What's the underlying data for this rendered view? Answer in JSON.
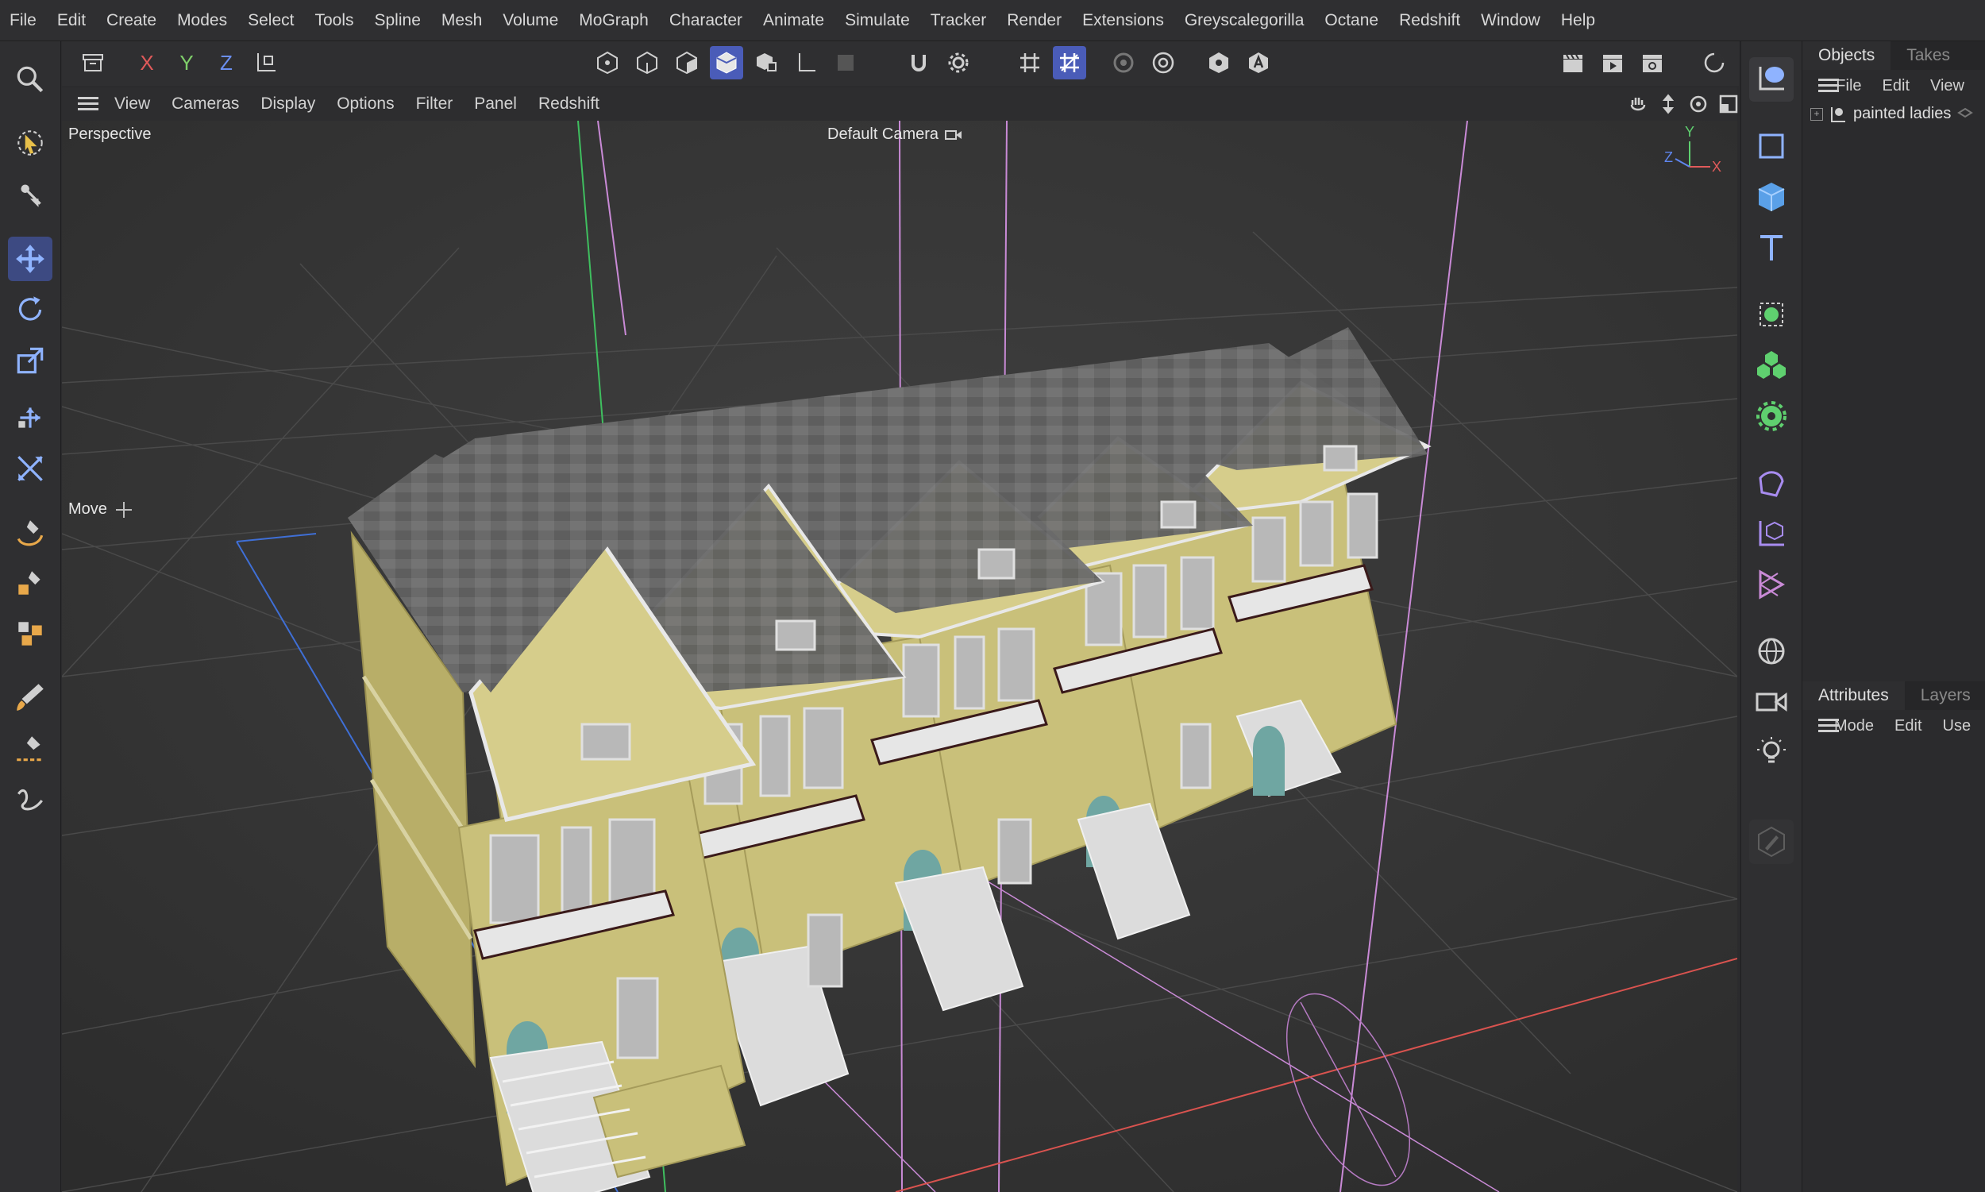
{
  "menu": [
    "File",
    "Edit",
    "Create",
    "Modes",
    "Select",
    "Tools",
    "Spline",
    "Mesh",
    "Volume",
    "MoGraph",
    "Character",
    "Animate",
    "Simulate",
    "Tracker",
    "Render",
    "Extensions",
    "Greyscalegorilla",
    "Octane",
    "Redshift",
    "Window",
    "Help"
  ],
  "toolbar": {
    "x_label": "X",
    "y_label": "Y",
    "z_label": "Z"
  },
  "viewport_menu": [
    "View",
    "Cameras",
    "Display",
    "Options",
    "Filter",
    "Panel",
    "Redshift"
  ],
  "viewport": {
    "view_name": "Perspective",
    "camera": "Default Camera",
    "tool_label": "Move",
    "axis_x": "X",
    "axis_y": "Y",
    "axis_z": "Z"
  },
  "objects_panel": {
    "tabs": [
      "Objects",
      "Takes"
    ],
    "menu": [
      "File",
      "Edit",
      "View"
    ],
    "tree_item": "painted ladies"
  },
  "attributes_panel": {
    "tabs": [
      "Attributes",
      "Layers"
    ],
    "menu": [
      "Mode",
      "Edit",
      "Use"
    ]
  },
  "colors": {
    "accent": "#4a5cb8",
    "house_wall": "#c9c07a",
    "roof": "#6e6e6e",
    "window": "#b8b8b8",
    "door": "#6fa6a2",
    "stairs": "#dcdcdc"
  }
}
